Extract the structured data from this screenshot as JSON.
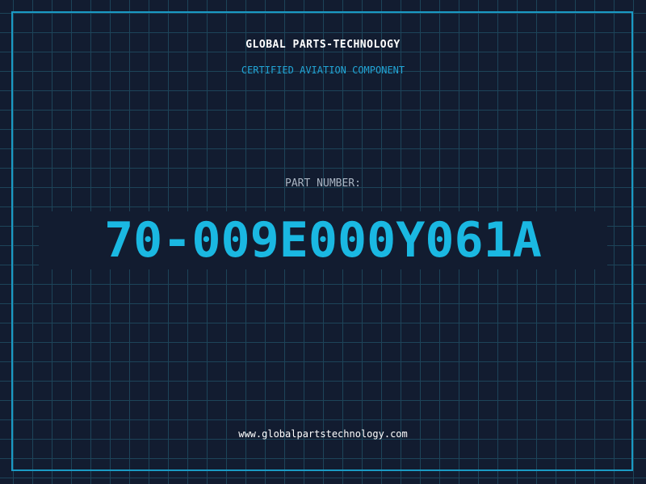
{
  "header": {
    "company": "GLOBAL PARTS-TECHNOLOGY",
    "subtitle": "CERTIFIED AVIATION COMPONENT"
  },
  "part": {
    "label": "PART NUMBER:",
    "number": "70-009E000Y061A"
  },
  "footer": {
    "website": "www.globalpartstechnology.com"
  },
  "colors": {
    "background": "#121c30",
    "grid": "#1d4459",
    "accent": "#1ab8e2",
    "frame": "#1a9ac4"
  }
}
